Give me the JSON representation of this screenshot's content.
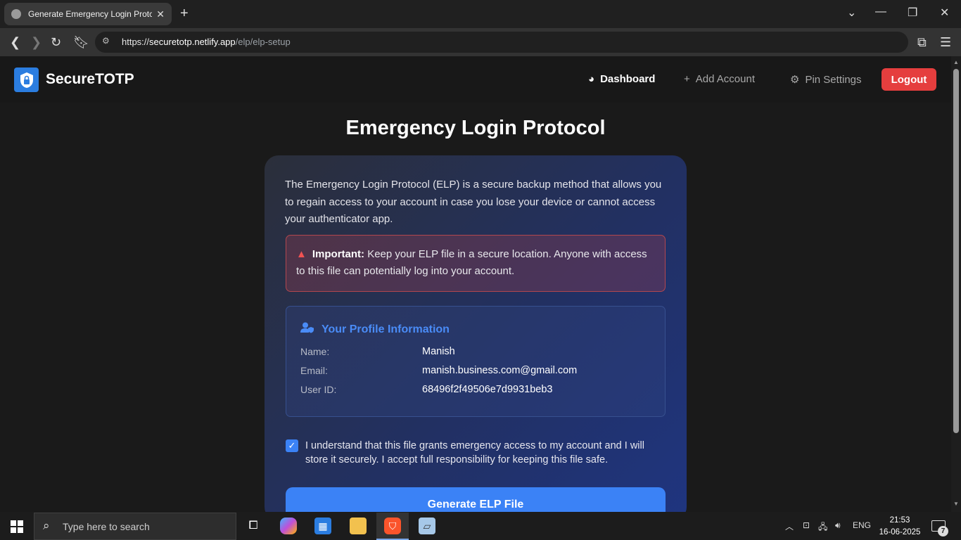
{
  "browser": {
    "tab_title": "Generate Emergency Login Protc",
    "url_scheme": "https://",
    "url_host": "securetotp.netlify.app",
    "url_path": "/elp/elp-setup"
  },
  "app": {
    "brand": "SecureTOTP",
    "nav": {
      "dashboard": "Dashboard",
      "add_account": "Add Account",
      "pin_settings": "Pin Settings",
      "logout": "Logout"
    }
  },
  "page": {
    "title": "Emergency Login Protocol",
    "intro": "The Emergency Login Protocol (ELP) is a secure backup method that allows you to regain access to your account in case you lose your device or cannot access your authenticator app.",
    "warning_bold": "Important:",
    "warning_text": "Keep your ELP file in a secure location. Anyone with access to this file can potentially log into your account.",
    "profile": {
      "heading": "Your Profile Information",
      "name_label": "Name:",
      "name_value": "Manish",
      "email_label": "Email:",
      "email_value": "manish.business.com@gmail.com",
      "userid_label": "User ID:",
      "userid_value": "68496f2f49506e7d9931beb3"
    },
    "agreement": "I understand that this file grants emergency access to my account and I will store it securely. I accept full responsibility for keeping this file safe.",
    "agreement_checked": true,
    "generate_button": "Generate ELP File"
  },
  "taskbar": {
    "search_placeholder": "Type here to search",
    "language": "ENG",
    "time": "21:53",
    "date": "16-06-2025",
    "notification_count": "7"
  },
  "colors": {
    "accent": "#3b82f6",
    "danger": "#e53e3e",
    "brand_blue": "#2b7de0"
  }
}
